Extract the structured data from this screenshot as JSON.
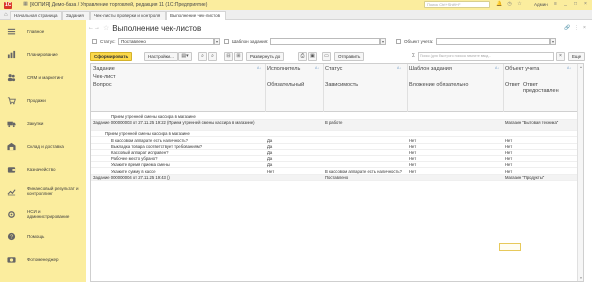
{
  "app": {
    "logo_text": "1С",
    "title": "[КОПИЯ] Демо-база / Управление торговлей, редакция 11  (1С:Предприятие)",
    "search_placeholder": "Поиск Ctrl+Shift+F",
    "user": "Админ"
  },
  "tabs": [
    {
      "label": "Начальная страница"
    },
    {
      "label": "Задания"
    },
    {
      "label": "Чек-листы проверки и контроля"
    },
    {
      "label": "Выполнение чек-листов"
    }
  ],
  "sidebar": {
    "items": [
      {
        "label": "Главное",
        "icon": "menu-icon"
      },
      {
        "label": "Планирование",
        "icon": "chart-icon"
      },
      {
        "label": "CRM и маркетинг",
        "icon": "people-icon"
      },
      {
        "label": "Продажи",
        "icon": "cart-icon"
      },
      {
        "label": "Закупки",
        "icon": "truck-icon"
      },
      {
        "label": "Склад и доставка",
        "icon": "warehouse-icon"
      },
      {
        "label": "Казначейство",
        "icon": "wallet-icon"
      },
      {
        "label": "Финансовый результат и контроллинг",
        "icon": "finance-icon"
      },
      {
        "label": "НСИ и администрирование",
        "icon": "settings-icon"
      },
      {
        "label": "Помощь",
        "icon": "help-icon"
      },
      {
        "label": "Фотоменеджер",
        "icon": "photo-icon"
      }
    ]
  },
  "page": {
    "title": "Выполнение чек-листов"
  },
  "filters": {
    "status_label": "Статус:",
    "status_value": "Поставлено",
    "template_label": "Шаблон задания:",
    "template_value": "",
    "object_label": "Объект учета:",
    "object_value": ""
  },
  "toolbar": {
    "generate": "Сформировать",
    "settings": "Настройки...",
    "expand": "Развернуть до",
    "send": "Отправить",
    "more": "Еще",
    "search_placeholder": "Поиск (для быстрого поиска начните ввод..."
  },
  "grid": {
    "headers": {
      "col1": [
        "Задание",
        "Чек-лист",
        "Вопрос"
      ],
      "col2": [
        "Исполнитель",
        "Обязательный"
      ],
      "col3": [
        "Статус",
        "Зависимость"
      ],
      "col4": [
        "Шаблон задания",
        "Вложение обязательно"
      ],
      "col5": [
        "Объект учета",
        "Ответ",
        "Ответ предоставлен"
      ]
    },
    "rows": [
      {
        "level": 2,
        "c1": "Прием утренней смены кассира в магазине",
        "c2": "",
        "c3": "",
        "c4": "",
        "c5": "",
        "c6": ""
      },
      {
        "level": 0,
        "c1": "Задание 000000003 от 27.11.25 19:22 (Прием утренней смены кассира в магазине)",
        "c2": "",
        "c3": "В работе",
        "c4": "",
        "c5": "Магазин \"Бытовая техника\"",
        "c6": ""
      },
      {
        "level": 1,
        "c1": "Прием утренней смены кассира в магазине",
        "c2": "",
        "c3": "",
        "c4": "",
        "c5": "",
        "c6": ""
      },
      {
        "level": 2,
        "c1": "В кассовом аппарате есть наличность?",
        "c2": "Да",
        "c3": "",
        "c4": "Нет",
        "c5": "Нет",
        "c6": ""
      },
      {
        "level": 2,
        "c1": "Выкладка товара соответствует требованиям?",
        "c2": "Да",
        "c3": "",
        "c4": "Нет",
        "c5": "Нет",
        "c6": ""
      },
      {
        "level": 2,
        "c1": "Кассовый аппарат исправен?",
        "c2": "Да",
        "c3": "",
        "c4": "Нет",
        "c5": "Нет",
        "c6": ""
      },
      {
        "level": 2,
        "c1": "Рабочее место убрано?",
        "c2": "Да",
        "c3": "",
        "c4": "Нет",
        "c5": "Нет",
        "c6": ""
      },
      {
        "level": 2,
        "c1": "Укажите время приема смены",
        "c2": "Да",
        "c3": "",
        "c4": "Нет",
        "c5": "Нет",
        "c6": ""
      },
      {
        "level": 2,
        "c1": "Укажите сумму в кассе",
        "c2": "Нет",
        "c3": "В кассовом аппарате есть наличность?",
        "c4": "Нет",
        "c5": "Нет",
        "c6": ""
      },
      {
        "level": 0,
        "c1": "Задание 000000004 от 27.11.25 19:43 ()",
        "c2": "",
        "c3": "Поставлено",
        "c4": "",
        "c5": "Магазин \"Продукты\"",
        "c6": ""
      }
    ]
  }
}
